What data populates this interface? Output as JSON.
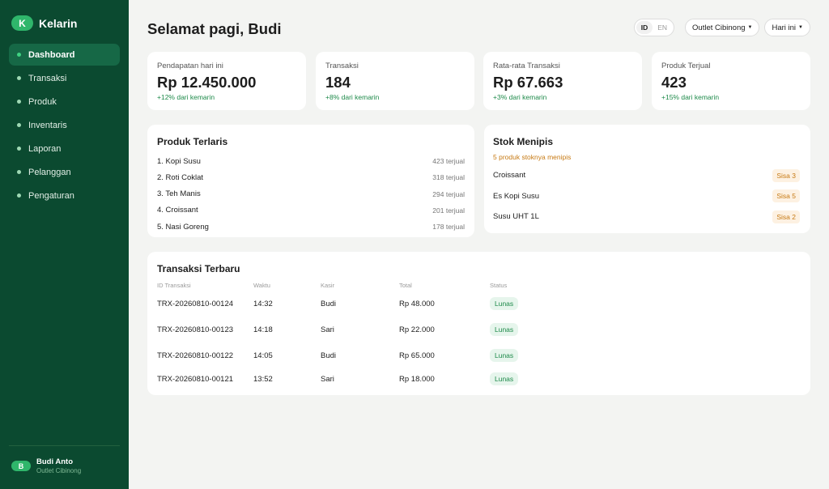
{
  "brand": {
    "logo_letter": "K",
    "name": "Kelarin"
  },
  "nav": [
    {
      "label": "Dashboard",
      "active": true
    },
    {
      "label": "Transaksi",
      "active": false
    },
    {
      "label": "Produk",
      "active": false
    },
    {
      "label": "Inventaris",
      "active": false
    },
    {
      "label": "Laporan",
      "active": false
    },
    {
      "label": "Pelanggan",
      "active": false
    },
    {
      "label": "Pengaturan",
      "active": false
    }
  ],
  "user": {
    "initial": "B",
    "name": "Budi Anto",
    "outlet": "Outlet Cibinong"
  },
  "header": {
    "greeting": "Selamat pagi, Budi",
    "lang_options": [
      "ID",
      "EN"
    ],
    "lang_selected": "ID",
    "outlet_select": "Outlet Cibinong",
    "period_select": "Hari ini"
  },
  "kpis": [
    {
      "label": "Pendapatan hari ini",
      "value": "Rp 12.450.000",
      "delta": "+12% dari kemarin"
    },
    {
      "label": "Transaksi",
      "value": "184",
      "delta": "+8% dari kemarin"
    },
    {
      "label": "Rata-rata Transaksi",
      "value": "Rp 67.663",
      "delta": "+3% dari kemarin"
    },
    {
      "label": "Produk Terjual",
      "value": "423",
      "delta": "+15% dari kemarin"
    }
  ],
  "top_products": {
    "title": "Produk Terlaris",
    "items": [
      {
        "name": "1. Kopi Susu",
        "sold": "423 terjual"
      },
      {
        "name": "2. Roti Coklat",
        "sold": "318 terjual"
      },
      {
        "name": "3. Teh Manis",
        "sold": "294 terjual"
      },
      {
        "name": "4. Croissant",
        "sold": "201 terjual"
      },
      {
        "name": "5. Nasi Goreng",
        "sold": "178 terjual"
      }
    ]
  },
  "low_stock": {
    "title": "Stok Menipis",
    "subtitle": "5 produk stoknya menipis",
    "items": [
      {
        "name": "Croissant",
        "remaining": "Sisa 3"
      },
      {
        "name": "Es Kopi Susu",
        "remaining": "Sisa 5"
      },
      {
        "name": "Susu UHT 1L",
        "remaining": "Sisa 2"
      }
    ]
  },
  "recent": {
    "title": "Transaksi Terbaru",
    "columns": [
      "ID Transaksi",
      "Waktu",
      "Kasir",
      "Total",
      "Status"
    ],
    "rows": [
      {
        "id": "TRX-20260810-00124",
        "time": "14:32",
        "cashier": "Budi",
        "total": "Rp 48.000",
        "status": "Lunas"
      },
      {
        "id": "TRX-20260810-00123",
        "time": "14:18",
        "cashier": "Sari",
        "total": "Rp 22.000",
        "status": "Lunas"
      },
      {
        "id": "TRX-20260810-00122",
        "time": "14:05",
        "cashier": "Budi",
        "total": "Rp 65.000",
        "status": "Lunas"
      },
      {
        "id": "TRX-20260810-00121",
        "time": "13:52",
        "cashier": "Sari",
        "total": "Rp 18.000",
        "status": "Lunas"
      }
    ]
  },
  "colors": {
    "sidebar": "#0b4a30",
    "sidebar_active": "#166846",
    "accent": "#2fb66b",
    "positive": "#1e8a4a",
    "warning": "#c77a14",
    "background": "#f3f4f2"
  }
}
